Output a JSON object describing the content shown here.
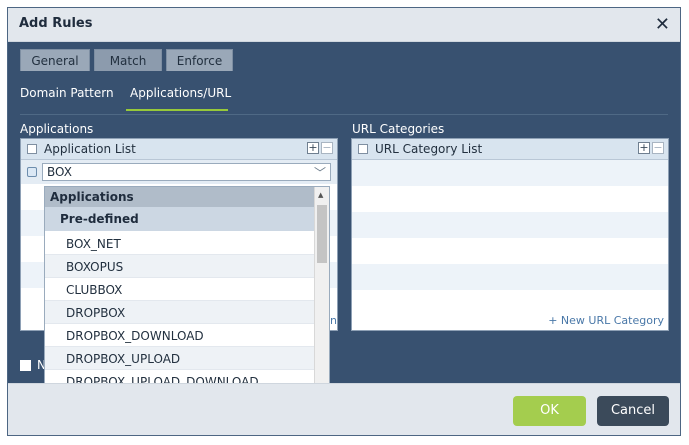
{
  "dialog": {
    "title": "Add Rules"
  },
  "tabs": [
    {
      "label": "General"
    },
    {
      "label": "Match",
      "active": true
    },
    {
      "label": "Enforce"
    }
  ],
  "subtabs": [
    {
      "label": "Domain Pattern"
    },
    {
      "label": "Applications/URL",
      "active": true
    }
  ],
  "applications": {
    "section_label": "Applications",
    "column_header": "Application List",
    "search_value": "BOX"
  },
  "url_categories": {
    "section_label": "URL Categories",
    "column_header": "URL Category List",
    "new_link": "+ New URL Category"
  },
  "dropdown": {
    "group_label": "Applications",
    "subgroup_label": "Pre-defined",
    "items": [
      "BOX_NET",
      "BOXOPUS",
      "CLUBBOX",
      "DROPBOX",
      "DROPBOX_DOWNLOAD",
      "DROPBOX_UPLOAD",
      "DROPBOX_UPLOAD_DOWNLOAD"
    ]
  },
  "partial_text": {
    "behind_dropdown_bottom_label": "N",
    "behind_dropdown_link": "n"
  },
  "buttons": {
    "ok": "OK",
    "cancel": "Cancel"
  },
  "colors": {
    "dialog_bg": "#385170",
    "accent_green": "#a4cd4e",
    "cancel_bg": "#3b4a5a",
    "link_blue": "#4a78a8"
  }
}
